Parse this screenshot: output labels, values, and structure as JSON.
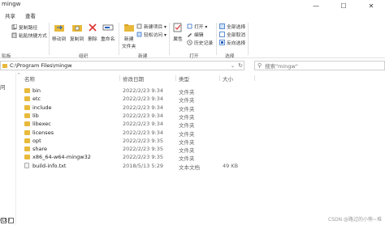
{
  "window": {
    "title": "mingw",
    "controls": [
      "—",
      "☐",
      "✕"
    ]
  },
  "ribbon": {
    "tabs": [
      "共享",
      "查看"
    ],
    "clipboard": {
      "copy_path": "复制路径",
      "paste_shortcut": "粘贴快捷方式",
      "group_label": "贴板"
    },
    "organize": {
      "move_to": "移动到",
      "copy_to": "复制到",
      "delete": "删除",
      "rename": "重命名",
      "group_label": "组织"
    },
    "new": {
      "new_folder_line1": "新建",
      "new_folder_line2": "文件夹",
      "new_item": "新建项目 ▾",
      "easy_access": "轻松访问 ▾",
      "group_label": "新建"
    },
    "open": {
      "properties": "属性",
      "open": "打开 ▾",
      "edit": "编辑",
      "history": "历史记录",
      "group_label": "打开"
    },
    "select": {
      "select_all": "全部选择",
      "select_none": "全部取消",
      "invert": "反向选择",
      "group_label": "选择"
    }
  },
  "address": {
    "path": "C:\\Program Files\\mingw",
    "search_placeholder": "搜索\"mingw\""
  },
  "left_pane": {
    "items": [
      "问",
      "(D:)"
    ]
  },
  "columns": {
    "name": "名称",
    "modified": "修改日期",
    "type": "类型",
    "size": "大小"
  },
  "files": [
    {
      "name": "bin",
      "date": "2022/2/23 9:34",
      "type": "文件夹",
      "size": "",
      "icon": "folder"
    },
    {
      "name": "etc",
      "date": "2022/2/23 9:34",
      "type": "文件夹",
      "size": "",
      "icon": "folder"
    },
    {
      "name": "include",
      "date": "2022/2/23 9:34",
      "type": "文件夹",
      "size": "",
      "icon": "folder"
    },
    {
      "name": "lib",
      "date": "2022/2/23 9:34",
      "type": "文件夹",
      "size": "",
      "icon": "folder"
    },
    {
      "name": "libexec",
      "date": "2022/2/23 9:34",
      "type": "文件夹",
      "size": "",
      "icon": "folder"
    },
    {
      "name": "licenses",
      "date": "2022/2/23 9:34",
      "type": "文件夹",
      "size": "",
      "icon": "folder"
    },
    {
      "name": "opt",
      "date": "2022/2/23 9:35",
      "type": "文件夹",
      "size": "",
      "icon": "folder"
    },
    {
      "name": "share",
      "date": "2022/2/23 9:35",
      "type": "文件夹",
      "size": "",
      "icon": "folder"
    },
    {
      "name": "x86_64-w64-mingw32",
      "date": "2022/2/23 9:35",
      "type": "文件夹",
      "size": "",
      "icon": "folder"
    },
    {
      "name": "build-info.txt",
      "date": "2018/5/13 5:29",
      "type": "文本文档",
      "size": "49 KB",
      "icon": "file"
    }
  ],
  "watermark": "CSDN @路过的小熊~堆"
}
